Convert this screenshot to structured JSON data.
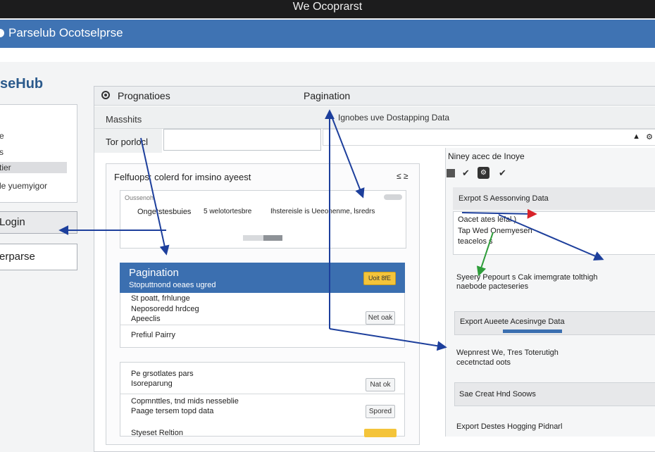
{
  "window": {
    "title": "We Ocoprarst"
  },
  "app": {
    "brand": "Parselub Ocotselprse",
    "logo_text": "seHub"
  },
  "sidebar": {
    "items": [
      {
        "label": "e"
      },
      {
        "label": "s"
      },
      {
        "label": "tier",
        "selected": true
      },
      {
        "label": "le yuemyigor"
      }
    ],
    "login_label": "Login",
    "parse_label": "erparse"
  },
  "panel": {
    "header_title": "Prognatioes",
    "header_center": "Pagination",
    "row2_label": "Masshits",
    "row2_right": "Ignobes uve Dostapping Data",
    "input_label": "Tor porlocl"
  },
  "subpanel": {
    "title": "Felfuops: colerd for imsino ayeest",
    "chevrons": "≤ ≥",
    "card1": {
      "small_label": "Oussenoh",
      "col1": "Ongetstesbuies",
      "col2": "5 welotortesbre",
      "col3": "Ihstereisle is Ueeonenme, lsredrs"
    },
    "blue_bar": {
      "title": "Pagination",
      "subtitle": "Stoputtnond oeaes ugred",
      "button": "Uoit 8fE"
    },
    "card2": {
      "lines": [
        "St poatt, frhlunge",
        "Neposoredd hrdceg",
        "Apeeclis"
      ],
      "bottom": "Prefiul Pairry",
      "button": "Net oak"
    },
    "card3": {
      "line1": "Pe grsotlates pars",
      "line2": "Isoreparung",
      "line3": "Copmnttles, tnd mids nesseblie",
      "line4": "Paage tersem topd data",
      "line5": "Styeset Reltion",
      "btn1": "Nat ok",
      "btn2": "Spored"
    }
  },
  "right": {
    "header_label": "Niney acec de Inoye",
    "export_title": "Exrpot S Aessonving Data",
    "box_lines": [
      "Oacet ates lefal )",
      "Tap Wed Onemyesen",
      "teacelos s"
    ],
    "desc1": "Syeery Pepourt s Cak imemgrate tolthigh",
    "desc1b": "naebode pacteseries",
    "export2": "Export Aueete Acesinvge Data",
    "desc2": "Wepnrest We, Tres Toterutigh",
    "desc2b": "cecetnctad oots",
    "save": "Sae Creat Hnd Soows",
    "export3": "Export Destes Hogging Pidnarl"
  },
  "colors": {
    "header_blue": "#3f73b3",
    "arrow_blue": "#1d3f9c",
    "arrow_green": "#2e9d3a",
    "arrow_red": "#d8232a",
    "button_yellow": "#f4c43a"
  },
  "icons": [
    "target-icon",
    "check-icon",
    "gear-icon",
    "puzzle-icon",
    "chevron-icon"
  ]
}
